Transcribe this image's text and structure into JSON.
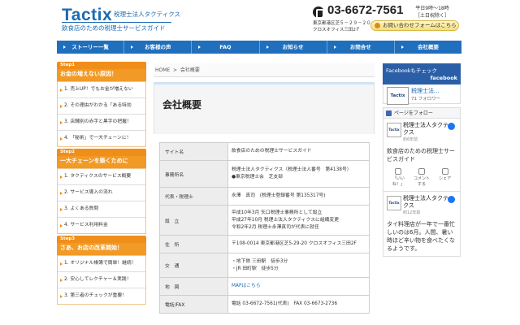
{
  "header": {
    "logo_main": "Tactix",
    "logo_sub": "税理士法人タクティクス",
    "tagline": "飲食店のための税理士サービスガイド",
    "tel": "03-6672-7561",
    "hours_line1": "平日9時～18時",
    "hours_line2": "［土日祝除く］",
    "address_line1": "東京都港区芝５－２９－２０",
    "address_line2": "クロスオフィス三田2Ｆ",
    "contact_button": "お問い合わせフォームはこちら"
  },
  "nav": {
    "items": [
      "ストーリー一覧",
      "お客様の声",
      "FAQ",
      "お知らせ",
      "お問合せ",
      "会社概要"
    ]
  },
  "sidebar": {
    "steps": [
      {
        "badge": "Step1",
        "title": "お金の増えない原因！",
        "items": [
          "1. 売上UP！でもお金が増えない",
          "2. その理由がわかる「ある特効",
          "3. 店舗別の赤字と黒字の把握！",
          "4. 「秘術」で一大チェーンに！"
        ]
      },
      {
        "badge": "Step2",
        "title": "一大チェーンを築くために",
        "items": [
          "1. タクティクスのサービス概要",
          "2. サービス導入の流れ",
          "3. よくある質問",
          "4. サービス利用料金"
        ]
      },
      {
        "badge": "Step3",
        "title": "さあ、お店の改革開始！",
        "items": [
          "1. オリジナル帳簿で簡単！継続！",
          "2. 安心してレクチャー＆実践！",
          "3. 第三者のチェックが重要！"
        ]
      }
    ]
  },
  "main": {
    "breadcrumb_home": "HOME",
    "breadcrumb_sep": ">",
    "breadcrumb_current": "会社概要",
    "page_title": "会社概要",
    "rows": [
      {
        "label": "サイト名",
        "lines": [
          "飲食店のための税理士サービスガイド"
        ]
      },
      {
        "label": "事務所名",
        "lines": [
          "税理士法人タクティクス（税理士法人番号　第4138号）",
          "●東京税理士会　芝支部"
        ]
      },
      {
        "label": "代表・税理士",
        "lines": [
          "永澤　真司　(税理士登録番号 第135317号)"
        ]
      },
      {
        "label": "設　立",
        "lines": [
          "平成10年3月 矢口税理士事務所として設立",
          "平成27年10月 税理士法人タクティクスに組織変更",
          "令和2年2月 税理士永澤真司が代表に就任"
        ]
      },
      {
        "label": "住　所",
        "lines": [
          "〒108-0014 東京都港区芝5-29-20 クロスオフィス三田2F"
        ]
      },
      {
        "label": "交　通",
        "lines": [
          "・地下鉄 三田駅　徒歩3分",
          "・JR 田町駅　徒歩5分"
        ]
      },
      {
        "label": "地　図",
        "link": "MAPはこちら"
      },
      {
        "label": "電話/FAX",
        "lines": [
          "電話 03-6672-7561(代表)　FAX 03-6673-2736"
        ]
      }
    ]
  },
  "facebook": {
    "header_line1": "Facebookもチェック",
    "header_line2": "facebook",
    "page_name": "税理士法...",
    "followers": "71 フォロワー",
    "logo_text": "Tactix",
    "like_button": "ページをフォロー",
    "posts": [
      {
        "name": "税理士法人タクティクス",
        "time": "約6年前",
        "body": "飲食店のための税理士サービスガイド",
        "actions": [
          "「いいね！」",
          "コメントする",
          "シェア"
        ]
      },
      {
        "name": "税理士法人タクティクス",
        "time": "約12年前",
        "body": "タイ料理店が一年で一番忙しいのは6月。人間、暑い時ほど辛い物を食べたくなるようです。"
      }
    ]
  }
}
